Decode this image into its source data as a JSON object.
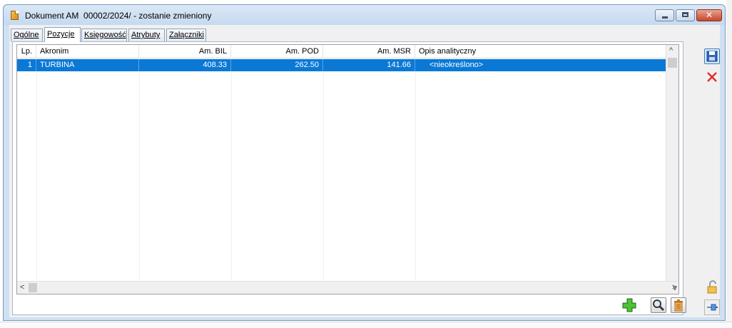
{
  "window": {
    "title": "Dokument AM  00002/2024/ - zostanie zmieniony",
    "close_glyph": "✕"
  },
  "tabs": [
    {
      "label": "Ogólne",
      "active": false
    },
    {
      "label": "Pozycje",
      "active": true
    },
    {
      "label": "Księgowość",
      "active": false
    },
    {
      "label": "Atrybuty",
      "active": false
    },
    {
      "label": "Załączniki",
      "active": false
    }
  ],
  "grid": {
    "columns": [
      "Lp.",
      "Akronim",
      "Am. BIL",
      "Am. POD",
      "Am. MSR",
      "Opis analityczny"
    ],
    "rows": [
      {
        "lp": "1",
        "akronim": "TURBINA",
        "am_bil": "408.33",
        "am_pod": "262.50",
        "am_msr": "141.66",
        "opis": "<nieokreślono>",
        "selected": true
      }
    ]
  },
  "scrollbar_glyphs": {
    "left": "<",
    "right": ">",
    "up": "^",
    "down": "v"
  },
  "icons": {
    "save": "save-icon",
    "cancel": "cancel-icon",
    "add": "add-icon",
    "search": "search-icon",
    "delete": "trash-icon",
    "lock": "padlock-icon",
    "pin": "pin-icon"
  },
  "colors": {
    "selection": "#0a79d6",
    "window_frame": "#cfe0f2",
    "close_button": "#c6472c",
    "add_icon": "#3fae2a",
    "cancel_icon": "#e0302a"
  }
}
